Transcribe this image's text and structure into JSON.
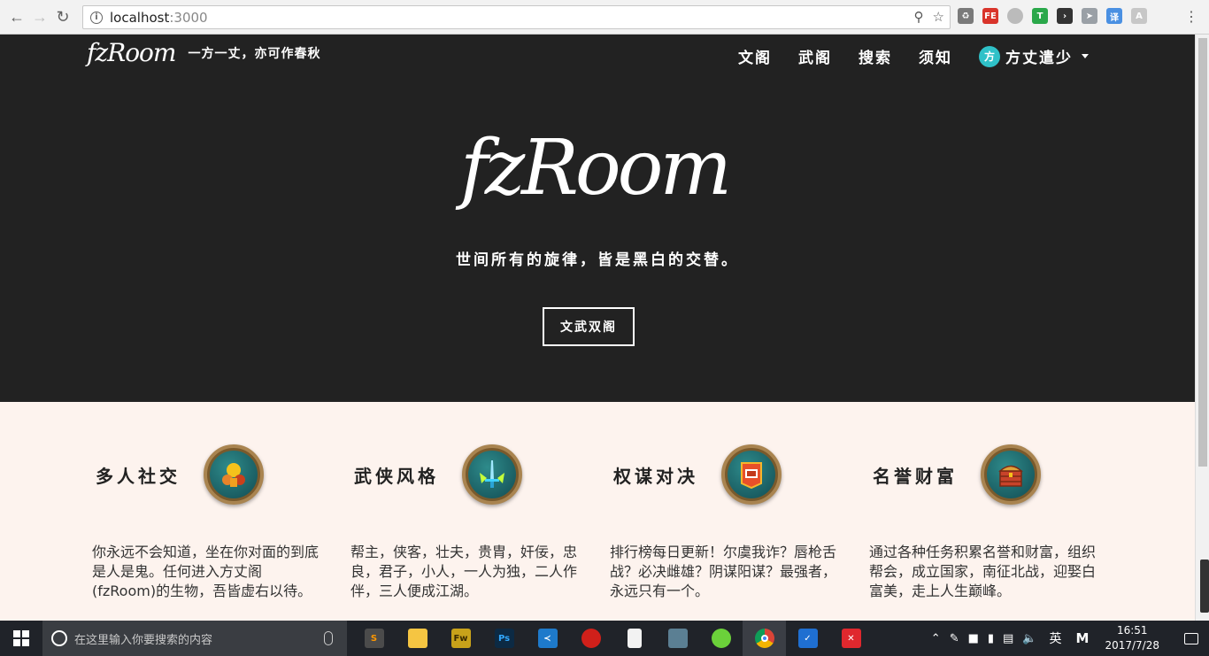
{
  "browser": {
    "url_host": "localhost",
    "url_port": ":3000",
    "back_icon": "back-arrow-icon",
    "forward_icon": "forward-arrow-icon",
    "reload_icon": "reload-icon",
    "extension_icons": [
      "recycle-icon",
      "fe-icon",
      "circle-icon",
      "shield-t-icon",
      "terminal-icon",
      "arrow-icon",
      "translate-icon",
      "a-icon"
    ],
    "translate_label": "译"
  },
  "site": {
    "brand_logo": "fzRoom",
    "brand_motto": "一方一丈，亦可作春秋",
    "nav": [
      "文阁",
      "武阁",
      "搜索",
      "须知"
    ],
    "user_avatar_text": "方",
    "user_name": "方丈遣少",
    "hero_logo": "fzRoom",
    "hero_tagline": "世间所有的旋律，皆是黑白的交替。",
    "hero_button": "文武双阁",
    "colors": {
      "dark_bg": "#222222",
      "features_bg": "#fdf3ee",
      "avatar": "#2fc1c8"
    }
  },
  "features": [
    {
      "title": "多人社交",
      "icon": "multiplayer-icon",
      "desc": "你永远不会知道，坐在你对面的到底是人是鬼。任何进入方丈阁(fzRoom)的生物，吾皆虚右以待。"
    },
    {
      "title": "武侠风格",
      "icon": "sword-icon",
      "desc": "帮主，侠客，壮夫，贵胄，奸佞，忠良，君子，小人，一人为独，二人作伴，三人便成江湖。"
    },
    {
      "title": "权谋对决",
      "icon": "banner-icon",
      "desc": "排行榜每日更新！尔虞我诈？唇枪舌战？必决雌雄？阴谋阳谋？最强者，永远只有一个。"
    },
    {
      "title": "名誉财富",
      "icon": "treasure-chest-icon",
      "desc": "通过各种任务积累名誉和财富，组织帮会，成立国家，南征北战，迎娶白富美，走上人生巅峰。"
    }
  ],
  "taskbar": {
    "search_placeholder": "在这里输入你要搜索的内容",
    "apps": [
      {
        "icon": "sublime-icon",
        "label": "S"
      },
      {
        "icon": "folder-icon",
        "label": ""
      },
      {
        "icon": "fireworks-icon",
        "label": "Fw"
      },
      {
        "icon": "photoshop-icon",
        "label": "Ps"
      },
      {
        "icon": "vscode-icon",
        "label": ""
      },
      {
        "icon": "butterfly-icon",
        "label": ""
      },
      {
        "icon": "document-icon",
        "label": ""
      },
      {
        "icon": "network-icon",
        "label": ""
      },
      {
        "icon": "wechat-icon",
        "label": ""
      },
      {
        "icon": "chrome-icon",
        "label": ""
      },
      {
        "icon": "shield-icon",
        "label": ""
      },
      {
        "icon": "xmind-icon",
        "label": ""
      }
    ],
    "ime_lang": "英",
    "ime_mode": "M",
    "time": "16:51",
    "date": "2017/7/28"
  }
}
